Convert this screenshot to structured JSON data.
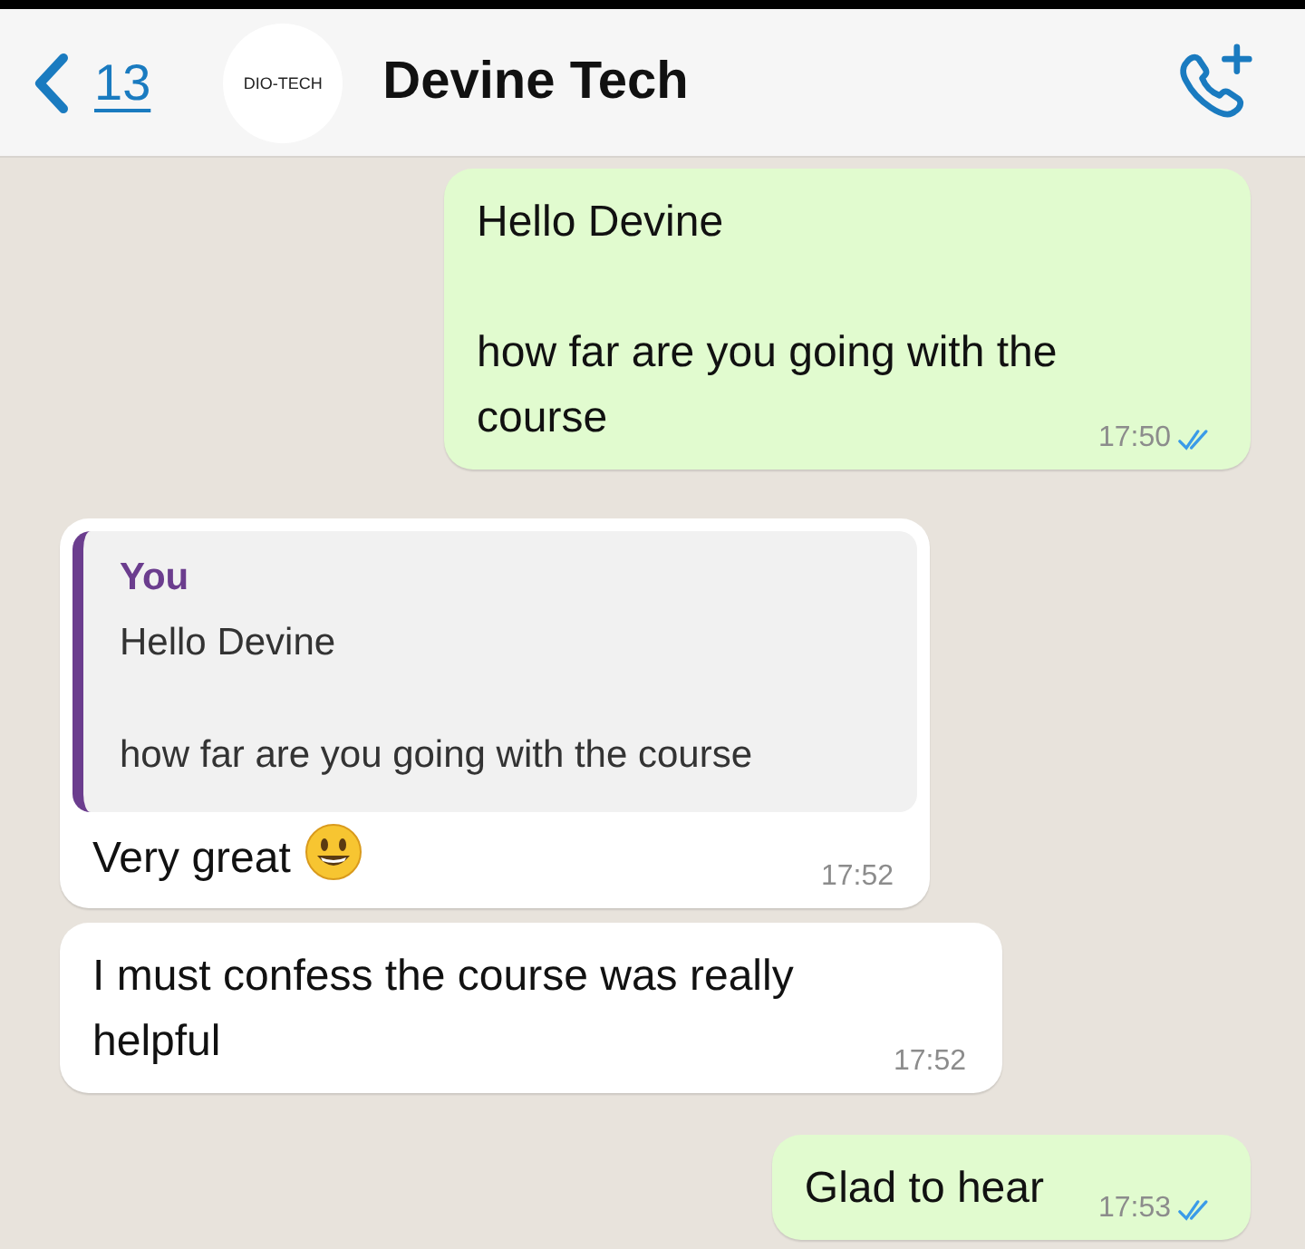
{
  "header": {
    "back_count": "13",
    "avatar_text": "DIO-TECH",
    "contact_name": "Devine Tech"
  },
  "messages": [
    {
      "kind": "outgoing",
      "text": "Hello Devine\n\nhow far are you going with the course",
      "time": "17:50",
      "read": true
    },
    {
      "kind": "incoming",
      "reply": {
        "author": "You",
        "text": "Hello Devine\n\nhow far are you going with the course"
      },
      "text": "Very great",
      "emoji": true,
      "time": "17:52"
    },
    {
      "kind": "incoming",
      "text": "I must confess the course was really helpful",
      "time": "17:52"
    },
    {
      "kind": "outgoing",
      "text": "Glad to hear",
      "time": "17:53",
      "read": true
    }
  ]
}
